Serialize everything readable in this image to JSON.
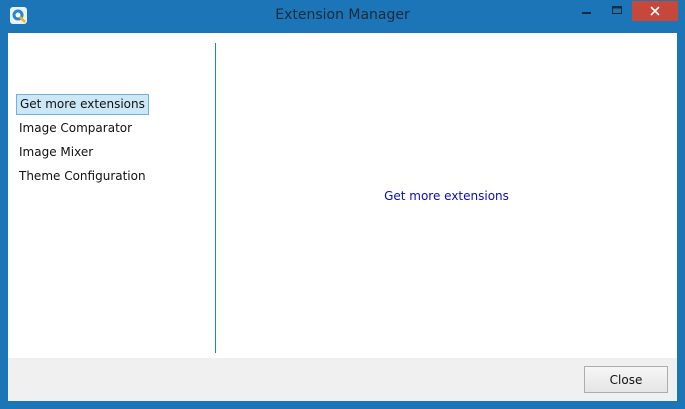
{
  "window": {
    "title": "Extension Manager",
    "accent_color": "#1c75b6",
    "close_hover_color": "#c7473a",
    "controls": [
      "minimize-icon",
      "maximize-icon",
      "close-icon"
    ]
  },
  "sidebar": {
    "items": [
      {
        "label": "Get more extensions",
        "selected": true
      },
      {
        "label": "Image Comparator",
        "selected": false
      },
      {
        "label": "Image Mixer",
        "selected": false
      },
      {
        "label": "Theme Configuration",
        "selected": false
      }
    ]
  },
  "content": {
    "link_text": "Get more extensions",
    "link_color": "#0b0bbd"
  },
  "footer": {
    "close_label": "Close"
  }
}
